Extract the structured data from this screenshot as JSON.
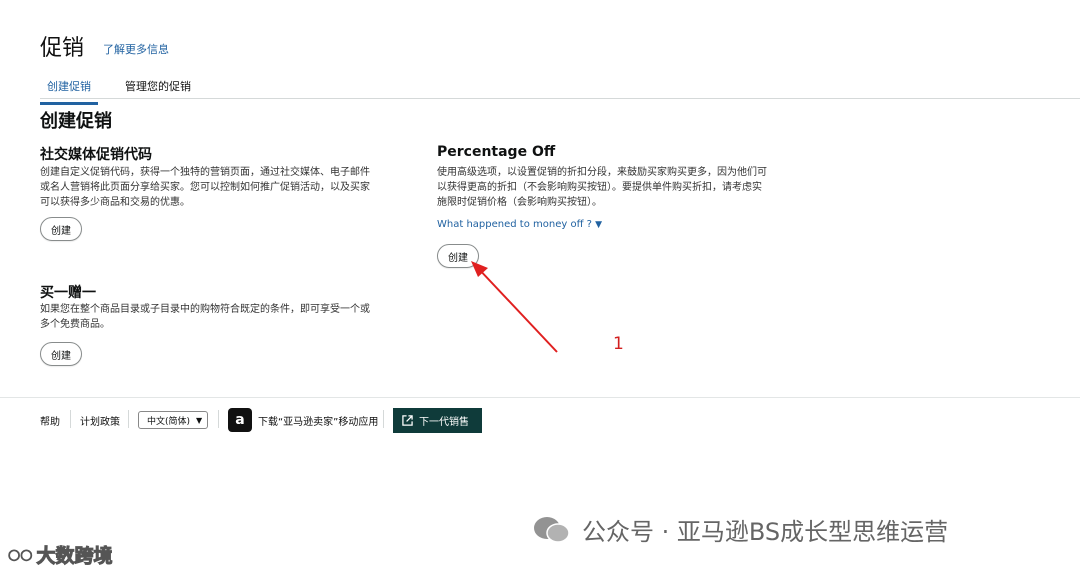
{
  "header": {
    "title": "促销",
    "learn_more": "了解更多信息"
  },
  "tabs": [
    {
      "label": "创建促销",
      "active": true
    },
    {
      "label": "管理您的促销",
      "active": false
    }
  ],
  "main": {
    "section_title": "创建促销",
    "cards": [
      {
        "title": "社交媒体促销代码",
        "desc_lines": [
          "创建自定义促销代码，获得一个独特的营销页面，通过社交媒体、电子邮件",
          "或名人营销将此页面分享给买家。您可以控制如何推广促销活动，以及买家",
          "可以获得多少商品和交易的优惠。"
        ],
        "button": "创建"
      },
      {
        "title": "买一赠一",
        "desc_lines": [
          "如果您在整个商品目录或子目录中的购物符合既定的条件，即可享受一个或",
          "多个免费商品。"
        ],
        "button": "创建"
      },
      {
        "title": "Percentage Off",
        "desc_lines": [
          "使用高级选项，以设置促销的折扣分段，来鼓励买家购买更多，因为他们可",
          "以获得更高的折扣（不会影响购买按钮）。要提供单件购买折扣，请考虑实",
          "施限时促销价格（会影响购买按钮）。"
        ],
        "link": "What happened to money off ?",
        "button": "创建"
      }
    ]
  },
  "annotation": {
    "number": "1",
    "color": "#e02020"
  },
  "footer": {
    "help": "帮助",
    "policy": "计划政策",
    "language": "中文(简体)",
    "app_download": "下载“亚马逊卖家”移动应用",
    "next_gen": "下一代销售"
  },
  "watermark": {
    "text": "公众号 · 亚马逊BS成长型思维运营",
    "brand": "大数跨境"
  },
  "colors": {
    "link": "#2162a1",
    "primary_button": "#0f3b3a",
    "arrow": "#e02020"
  }
}
